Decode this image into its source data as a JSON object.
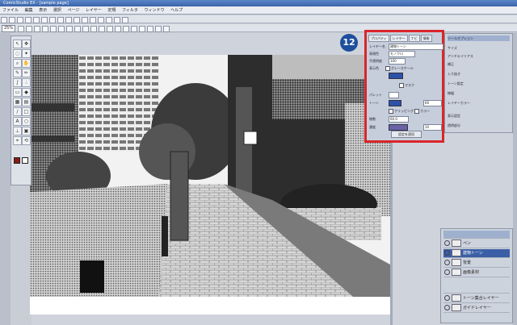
{
  "app": {
    "title": "ComicStudio EX - [sample page]",
    "menu": [
      "ファイル",
      "編集",
      "表示",
      "選択",
      "ページ",
      "レイヤー",
      "定規",
      "フィルタ",
      "ウィンドウ",
      "ヘルプ"
    ],
    "zoom": "25%"
  },
  "badge": {
    "label": "12"
  },
  "property_panel": {
    "tabs": [
      "プロパティ",
      "レイヤー",
      "ナビ",
      "情報"
    ],
    "rows": [
      {
        "label": "レイヤー名",
        "value": "建物トーン"
      },
      {
        "label": "表現色",
        "value": "モノクロ"
      },
      {
        "label": "不透明度",
        "value": "100"
      },
      {
        "label": "表示色",
        "value": "グレースケール"
      },
      {
        "label": "パレット",
        "value": ""
      },
      {
        "label": "トーン",
        "value": "60"
      },
      {
        "label": "線数",
        "value": "60.0"
      },
      {
        "label": "濃度",
        "value": "10"
      }
    ],
    "check_labels": [
      "マスク",
      "クリッピング",
      "カラー"
    ],
    "apply_label": "設定を適用"
  },
  "right_panel": {
    "rows": [
      "ツールオプション",
      "サイズ",
      "アンチエイリアス",
      "補正",
      "入り抜き",
      "トーン設定",
      "線幅",
      "レイヤーカラー",
      "表示設定",
      "透明部分"
    ]
  },
  "layers": {
    "items": [
      {
        "name": "ペン",
        "selected": false
      },
      {
        "name": "建物トーン",
        "selected": true
      },
      {
        "name": "背景",
        "selected": false
      },
      {
        "name": "画像素材",
        "selected": false
      },
      {
        "name": "",
        "selected": false
      },
      {
        "name": "トーン集合レイヤー",
        "selected": false
      },
      {
        "name": "ガイドレイヤー",
        "selected": false
      }
    ]
  },
  "colors": {
    "accent": "#d9262b",
    "badge": "#1d4f9c",
    "selection": "#3a5fa6"
  }
}
